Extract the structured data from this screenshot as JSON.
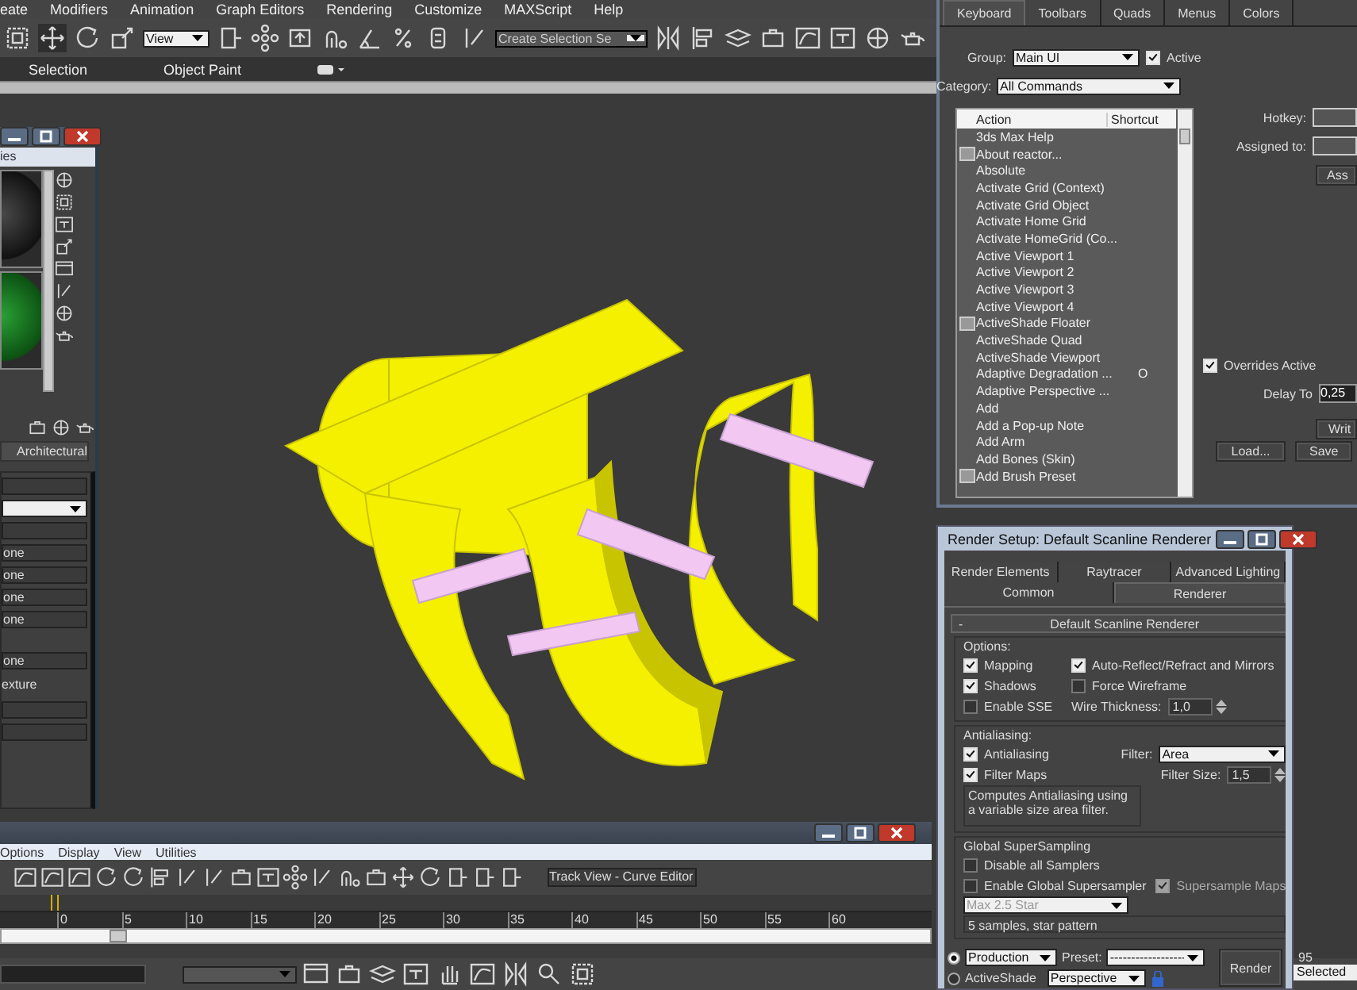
{
  "menu_bar": {
    "items": [
      "eate",
      "Modifiers",
      "Animation",
      "Graph Editors",
      "Rendering",
      "Customize",
      "MAXScript",
      "Help"
    ]
  },
  "main_toolbar": {
    "reference_dropdown": "View",
    "selection_set_field": "Create Selection Se"
  },
  "ribbon": {
    "tabs": [
      "Selection",
      "Object Paint"
    ]
  },
  "material_editor": {
    "title": "ies",
    "mode_button": "Architectural",
    "rows": [
      {
        "label": "one"
      },
      {
        "label": "one"
      },
      {
        "label": "one"
      },
      {
        "label": "one"
      },
      {
        "label": "one"
      }
    ],
    "map_label": "exture"
  },
  "customize_ui": {
    "tabs": [
      {
        "label": "Keyboard",
        "selected": true
      },
      {
        "label": "Toolbars",
        "selected": false
      },
      {
        "label": "Quads",
        "selected": false
      },
      {
        "label": "Menus",
        "selected": false
      },
      {
        "label": "Colors",
        "selected": false
      }
    ],
    "group_label": "Group:",
    "group": "Main UI",
    "active": {
      "label": "Active",
      "checked": true
    },
    "category_label": "Category:",
    "category": "All Commands",
    "columns": [
      "Action",
      "Shortcut"
    ],
    "actions": [
      {
        "name": "3ds Max Help",
        "has_icon": false
      },
      {
        "name": "About reactor...",
        "has_icon": true
      },
      {
        "name": "Absolute",
        "has_icon": false
      },
      {
        "name": "Activate Grid (Context)",
        "has_icon": false
      },
      {
        "name": "Activate Grid Object",
        "has_icon": false
      },
      {
        "name": "Activate Home Grid",
        "has_icon": false
      },
      {
        "name": "Activate HomeGrid (Co...",
        "has_icon": false
      },
      {
        "name": "Active Viewport 1",
        "has_icon": false
      },
      {
        "name": "Active Viewport 2",
        "has_icon": false
      },
      {
        "name": "Active Viewport 3",
        "has_icon": false
      },
      {
        "name": "Active Viewport 4",
        "has_icon": false
      },
      {
        "name": "ActiveShade Floater",
        "has_icon": true
      },
      {
        "name": "ActiveShade Quad",
        "has_icon": false
      },
      {
        "name": "ActiveShade Viewport",
        "has_icon": false
      },
      {
        "name": "Adaptive Degradation ...",
        "shortcut": "O",
        "has_icon": false
      },
      {
        "name": "Adaptive Perspective ...",
        "has_icon": false
      },
      {
        "name": "Add",
        "has_icon": false
      },
      {
        "name": "Add a Pop-up Note",
        "has_icon": false
      },
      {
        "name": "Add Arm",
        "has_icon": false
      },
      {
        "name": "Add Bones (Skin)",
        "has_icon": false
      },
      {
        "name": "Add Brush Preset",
        "has_icon": true
      }
    ],
    "hotkey_label": "Hotkey:",
    "assigned_label": "Assigned to:",
    "assign_button": "Ass",
    "overrides": {
      "label": "Overrides Active",
      "checked": true
    },
    "delay_label": "Delay To",
    "delay_value": "0,25",
    "write_button": "Writ",
    "load_button": "Load...",
    "save_button": "Save"
  },
  "render_setup": {
    "title": "Render Setup: Default Scanline Renderer",
    "tab_rows": [
      [
        {
          "label": "Render Elements",
          "selected": false
        },
        {
          "label": "Raytracer",
          "selected": false
        },
        {
          "label": "Advanced Lighting",
          "selected": false
        }
      ],
      [
        {
          "label": "Common",
          "selected": false
        },
        {
          "label": "Renderer",
          "selected": true
        }
      ]
    ],
    "rollout_toggle": "-",
    "rollout_title": "Default Scanline Renderer",
    "options": {
      "title": "Options:",
      "checks": [
        {
          "label": "Mapping",
          "checked": true
        },
        {
          "label": "Auto-Reflect/Refract and Mirrors",
          "checked": true
        },
        {
          "label": "Shadows",
          "checked": true
        },
        {
          "label": "Force Wireframe",
          "checked": false
        },
        {
          "label": "Enable SSE",
          "checked": false
        }
      ],
      "wire_label": "Wire Thickness:",
      "wire_value": "1,0"
    },
    "antialiasing": {
      "title": "Antialiasing:",
      "antialiasing": {
        "label": "Antialiasing",
        "checked": true
      },
      "filter_label": "Filter:",
      "filter": "Area",
      "filter_maps": {
        "label": "Filter Maps",
        "checked": true
      },
      "size_label": "Filter Size:",
      "size_value": "1,5",
      "description": "Computes Antialiasing using a variable size area filter."
    },
    "supersampling": {
      "title": "Global SuperSampling",
      "disable_all": {
        "label": "Disable all Samplers",
        "checked": false
      },
      "enable_global": {
        "label": "Enable Global Supersampler",
        "checked": false
      },
      "supersample_maps": {
        "label": "Supersample Maps",
        "checked": true,
        "disabled": true
      },
      "sampler": "Max 2.5 Star",
      "description": "5 samples, star pattern"
    },
    "modes": [
      {
        "kind": "dropdown",
        "label": "Production",
        "selected": true
      },
      {
        "kind": "plain",
        "label": "ActiveShade",
        "selected": false
      }
    ],
    "preset_label": "Preset:",
    "preset": "------------------",
    "view": "Perspective",
    "render_button": "Render"
  },
  "track_view": {
    "menus": [
      "Options",
      "Display",
      "View",
      "Utilities"
    ],
    "title_field": "Track View - Curve Editor",
    "ruler": [
      "0",
      "5",
      "10",
      "15",
      "20",
      "25",
      "30",
      "35",
      "40",
      "45",
      "50",
      "55",
      "60"
    ]
  },
  "status": {
    "frame": "95",
    "selection": "Selected"
  }
}
